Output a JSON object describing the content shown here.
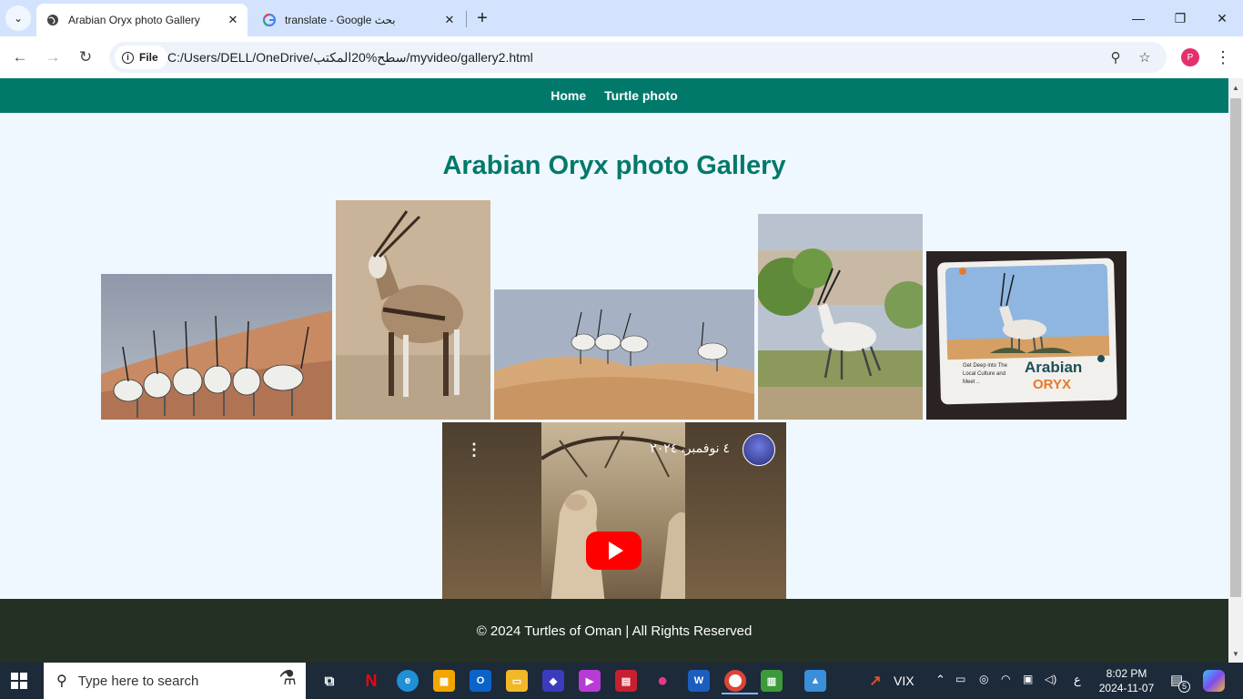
{
  "browser": {
    "tabs": [
      {
        "title": "Arabian Oryx photo Gallery",
        "active": true,
        "favicon": "globe-icon"
      },
      {
        "title": "translate - Google بحث",
        "active": false,
        "favicon": "google-icon"
      }
    ],
    "site_chip_label": "File",
    "url": "C:/Users/DELL/OneDrive/سطح%20المكتب/myvideo/gallery2.html",
    "profile_initial": "P"
  },
  "page": {
    "nav": {
      "links": [
        "Home",
        "Turtle photo"
      ]
    },
    "title": "Arabian Oryx photo Gallery",
    "photo_card": {
      "headline": "Arabian",
      "sub": "ORYX",
      "caption_lines": [
        "Get Deep into The",
        "Local Culture and",
        "Meet .."
      ]
    },
    "video": {
      "title": "٤ نوفمبر، ٢٠٢٤",
      "channel_avatar": "channel-avatar"
    },
    "footer": "© 2024 Turtles of Oman | All Rights Reserved"
  },
  "taskbar": {
    "search_placeholder": "Type here to search",
    "vix_label": "VIX",
    "language": "ع",
    "time": "8:02 PM",
    "date": "2024-11-07",
    "notification_count": "5"
  },
  "colors": {
    "brand": "#00796b",
    "page_bg": "#f0f8ff",
    "footer_bg": "#253025",
    "youtube_red": "#ff0000"
  }
}
